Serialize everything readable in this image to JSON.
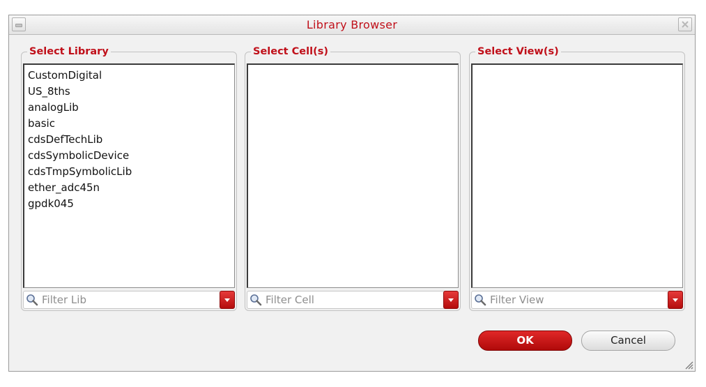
{
  "window": {
    "title": "Library Browser"
  },
  "panels": {
    "library": {
      "label": "Select Library",
      "items": [
        "CustomDigital",
        "US_8ths",
        "analogLib",
        "basic",
        "cdsDefTechLib",
        "cdsSymbolicDevice",
        "cdsTmpSymbolicLib",
        "ether_adc45n",
        "gpdk045"
      ],
      "filter_placeholder": "Filter Lib"
    },
    "cell": {
      "label": "Select Cell(s)",
      "items": [],
      "filter_placeholder": "Filter Cell"
    },
    "view": {
      "label": "Select View(s)",
      "items": [],
      "filter_placeholder": "Filter View"
    }
  },
  "buttons": {
    "ok": "OK",
    "cancel": "Cancel"
  },
  "colors": {
    "accent": "#c0101a",
    "ok_button": "#c81818"
  },
  "icons": [
    "minimize-icon",
    "close-icon",
    "search-icon",
    "dropdown-arrow-icon",
    "resize-grip-icon"
  ]
}
